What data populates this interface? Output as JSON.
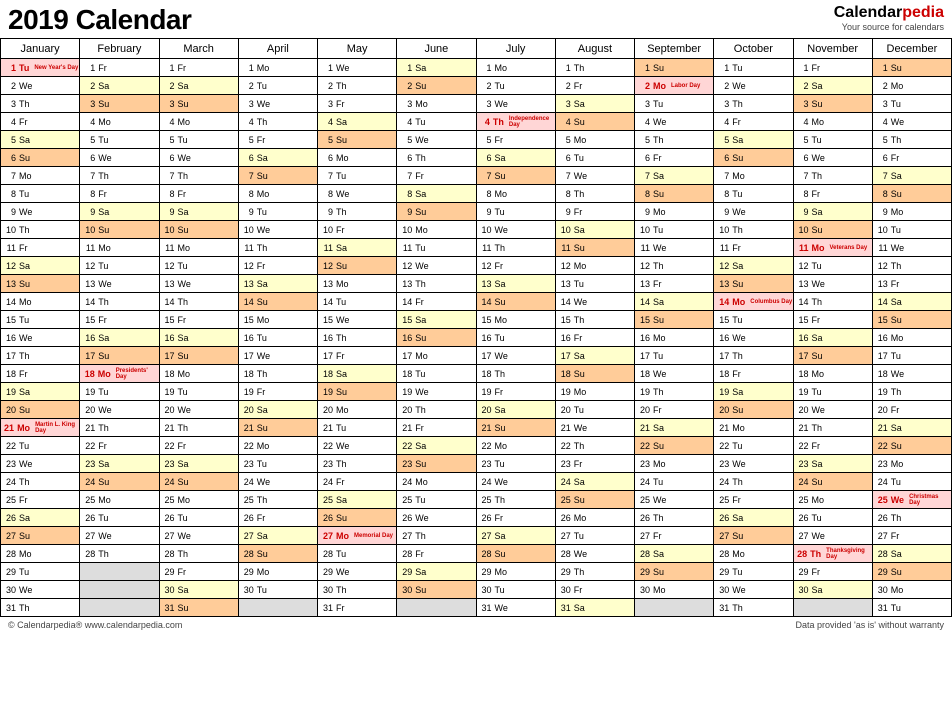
{
  "title": "2019 Calendar",
  "brand": {
    "name": "Calendar",
    "suffix": "pedia",
    "tag": "Your source for calendars"
  },
  "months": [
    "January",
    "February",
    "March",
    "April",
    "May",
    "June",
    "July",
    "August",
    "September",
    "October",
    "November",
    "December"
  ],
  "dow_labels": [
    "Mo",
    "Tu",
    "We",
    "Th",
    "Fr",
    "Sa",
    "Su"
  ],
  "start_dow": [
    1,
    4,
    4,
    0,
    2,
    5,
    0,
    3,
    6,
    1,
    4,
    6
  ],
  "days_in_month": [
    31,
    28,
    31,
    30,
    31,
    30,
    31,
    31,
    30,
    31,
    30,
    31
  ],
  "holidays": {
    "0": {
      "1": "New Year's Day",
      "21": "Martin L. King Day"
    },
    "1": {
      "18": "Presidents' Day"
    },
    "4": {
      "27": "Memorial Day"
    },
    "6": {
      "4": "Independence Day"
    },
    "8": {
      "2": "Labor Day"
    },
    "9": {
      "14": "Columbus Day"
    },
    "10": {
      "11": "Veterans Day",
      "28": "Thanksgiving Day"
    },
    "11": {
      "25": "Christmas Day"
    }
  },
  "footer_left": "© Calendarpedia®   www.calendarpedia.com",
  "footer_right": "Data provided 'as is' without warranty"
}
